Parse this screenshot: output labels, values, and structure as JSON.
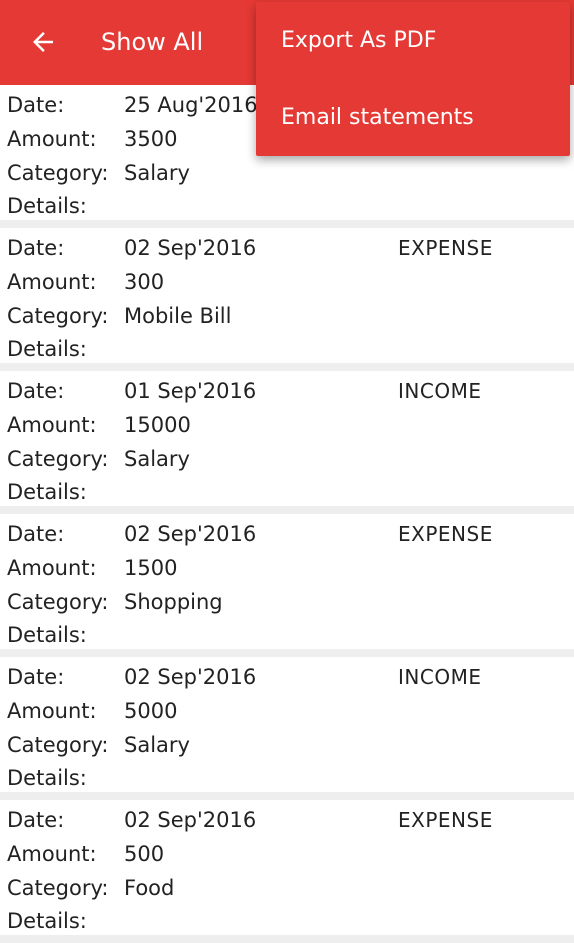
{
  "app_bar": {
    "back_icon": "arrow-back-icon",
    "title": "Show All",
    "color": "#e53935"
  },
  "overflow_menu": {
    "items": [
      {
        "label": "Export As PDF"
      },
      {
        "label": "Email statements"
      }
    ]
  },
  "labels": {
    "date": "Date:",
    "amount": "Amount:",
    "category": "Category:",
    "details": "Details:"
  },
  "transactions": [
    {
      "date": "25 Aug'2016",
      "amount": "3500",
      "category": "Salary",
      "details": "",
      "type": ""
    },
    {
      "date": "02 Sep'2016",
      "amount": "300",
      "category": "Mobile Bill",
      "details": "",
      "type": "EXPENSE"
    },
    {
      "date": "01 Sep'2016",
      "amount": "15000",
      "category": "Salary",
      "details": "",
      "type": "INCOME"
    },
    {
      "date": "02 Sep'2016",
      "amount": "1500",
      "category": "Shopping",
      "details": "",
      "type": "EXPENSE"
    },
    {
      "date": "02 Sep'2016",
      "amount": "5000",
      "category": "Salary",
      "details": "",
      "type": "INCOME"
    },
    {
      "date": "02 Sep'2016",
      "amount": "500",
      "category": "Food",
      "details": "",
      "type": "EXPENSE"
    }
  ]
}
